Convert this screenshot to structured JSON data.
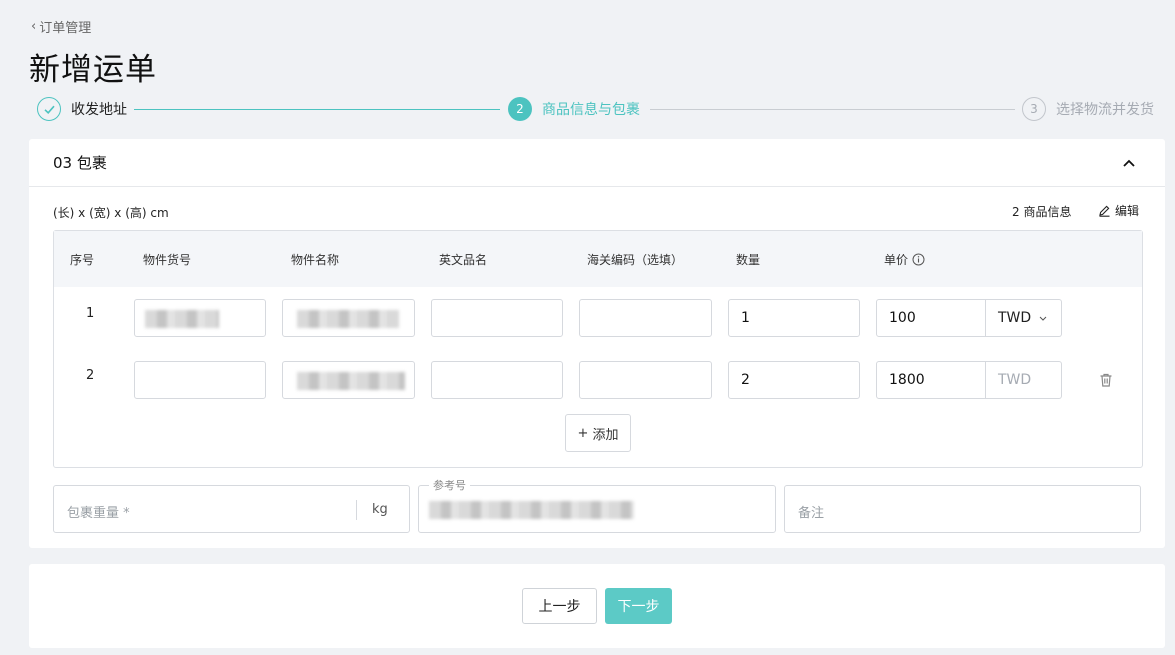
{
  "breadcrumb": {
    "label": "订单管理"
  },
  "page_title": "新增运单",
  "steps": [
    {
      "index": "✓",
      "label": "收发地址",
      "state": "done"
    },
    {
      "index": "2",
      "label": "商品信息与包裹",
      "state": "active"
    },
    {
      "index": "3",
      "label": "选择物流并发货",
      "state": "todo"
    }
  ],
  "colors": {
    "accent": "#4cc3c0",
    "next_button": "#5ccac6",
    "page_bg": "#f0f2f5"
  },
  "package_section": {
    "title": "03 包裹",
    "dims_label": "(长) x (宽) x (高) cm",
    "goods_info": "2 商品信息",
    "edit_label": "编辑",
    "columns": [
      "序号",
      "物件货号",
      "物件名称",
      "英文品名",
      "海关编码（选填）",
      "数量",
      "单价"
    ],
    "rows": [
      {
        "index": "1",
        "item_no": "",
        "item_name": "",
        "english_name": "",
        "hs_code": "",
        "quantity": "1",
        "unit_price": "100",
        "currency": "TWD"
      },
      {
        "index": "2",
        "item_no": "",
        "item_name": "",
        "english_name": "",
        "hs_code": "",
        "quantity": "2",
        "unit_price": "1800",
        "currency": "TWD"
      }
    ],
    "add_label": "添加",
    "weight_placeholder": "包裹重量 *",
    "weight_unit": "kg",
    "reference_label": "参考号",
    "remark_placeholder": "备注"
  },
  "footer": {
    "prev_label": "上一步",
    "next_label": "下一步"
  }
}
